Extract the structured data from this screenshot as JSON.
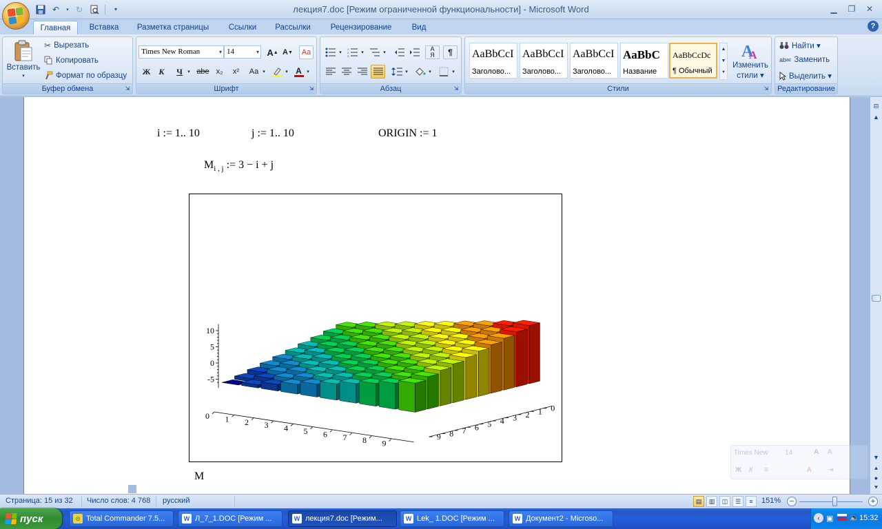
{
  "window": {
    "title": "лекция7.doc [Режим ограниченной функциональности] - Microsoft Word",
    "minimize": "▁",
    "restore": "❐",
    "close": "✕"
  },
  "tabs": [
    {
      "label": "Главная",
      "active": true
    },
    {
      "label": "Вставка"
    },
    {
      "label": "Разметка страницы"
    },
    {
      "label": "Ссылки"
    },
    {
      "label": "Рассылки"
    },
    {
      "label": "Рецензирование"
    },
    {
      "label": "Вид"
    }
  ],
  "help_label": "?",
  "clipboard": {
    "label": "Буфер обмена",
    "paste": "Вставить",
    "cut": "Вырезать",
    "copy": "Копировать",
    "format_painter": "Формат по образцу"
  },
  "font": {
    "label": "Шрифт",
    "family": "Times New Roman",
    "size": "14",
    "bold": "Ж",
    "italic": "К",
    "underline": "Ч",
    "strike": "abe",
    "subscript": "x₂",
    "superscript": "x²",
    "case": "Aa",
    "grow": "A",
    "shrink": "A",
    "color_letter": "A"
  },
  "paragraph": {
    "label": "Абзац",
    "pilcrow": "¶"
  },
  "styles": {
    "label": "Стили",
    "items": [
      {
        "sample": "AaBbCcI",
        "name": "Заголово..."
      },
      {
        "sample": "AaBbCcI",
        "name": "Заголово..."
      },
      {
        "sample": "AaBbCcI",
        "name": "Заголово..."
      },
      {
        "sample": "AaBbC",
        "name": "Название"
      },
      {
        "sample": "AaBbCcDc",
        "name": "¶ Обычный",
        "selected": true
      }
    ],
    "change_line1": "Изменить",
    "change_line2": "стили ▾"
  },
  "editing": {
    "label": "Редактирование",
    "find": "Найти ▾",
    "replace": "Заменить",
    "select": "Выделить ▾"
  },
  "doc": {
    "i_range": "i := 1.. 10",
    "j_range": "j := 1.. 10",
    "origin": "ORIGIN := 1",
    "m_def_base": "M",
    "m_def_sub": "i , j",
    "m_def_rhs": ":= 3 − i + j",
    "caption": "M"
  },
  "chart_data": {
    "type": "bar3d",
    "title": "",
    "formula": "M(i,j) = 3 - i + j",
    "rows": 10,
    "cols": 10,
    "z_ticks": [
      "10",
      "5",
      "0",
      "-5"
    ],
    "x_ticks": [
      "0",
      "1",
      "2",
      "3",
      "4",
      "5",
      "6",
      "7",
      "8",
      "9"
    ],
    "y_ticks": [
      "0",
      "1",
      "2",
      "3",
      "4",
      "5",
      "6",
      "7",
      "8",
      "9"
    ],
    "values": [
      [
        3,
        4,
        5,
        6,
        7,
        8,
        9,
        10,
        11,
        12
      ],
      [
        2,
        3,
        4,
        5,
        6,
        7,
        8,
        9,
        10,
        11
      ],
      [
        1,
        2,
        3,
        4,
        5,
        6,
        7,
        8,
        9,
        10
      ],
      [
        0,
        1,
        2,
        3,
        4,
        5,
        6,
        7,
        8,
        9
      ],
      [
        -1,
        0,
        1,
        2,
        3,
        4,
        5,
        6,
        7,
        8
      ],
      [
        -2,
        -1,
        0,
        1,
        2,
        3,
        4,
        5,
        6,
        7
      ],
      [
        -3,
        -2,
        -1,
        0,
        1,
        2,
        3,
        4,
        5,
        6
      ],
      [
        -4,
        -3,
        -2,
        -1,
        0,
        1,
        2,
        3,
        4,
        5
      ],
      [
        -5,
        -4,
        -3,
        -2,
        -1,
        0,
        1,
        2,
        3,
        4
      ],
      [
        -6,
        -5,
        -4,
        -3,
        -2,
        -1,
        0,
        1,
        2,
        3
      ]
    ],
    "color_scale": [
      "#00007a",
      "#0b3ea8",
      "#0a7bb8",
      "#00a8a0",
      "#00b84a",
      "#3cc800",
      "#a8d800",
      "#f0e000",
      "#f08c00",
      "#ff1a00"
    ]
  },
  "mini_toolbar": {
    "font": "Times New",
    "size": "14",
    "bold": "Ж",
    "italic": "К"
  },
  "status": {
    "page": "Страница: 15 из 32",
    "words": "Число слов: 4 768",
    "language": "русский",
    "zoom": "151%",
    "zoom_minus": "−",
    "zoom_plus": "+"
  },
  "taskbar": {
    "start": "пуск",
    "tasks": [
      {
        "label": "Total Commander 7.5...",
        "icon": "TC"
      },
      {
        "label": "Л_7_1.DOC [Режим ...",
        "icon": "W"
      },
      {
        "label": "лекция7.doc [Режим...",
        "icon": "W",
        "active": true
      },
      {
        "label": "Lek_ 1.DOC [Режим ...",
        "icon": "W"
      },
      {
        "label": "Документ2 - Microso...",
        "icon": "W"
      }
    ],
    "clock": "15:32"
  }
}
